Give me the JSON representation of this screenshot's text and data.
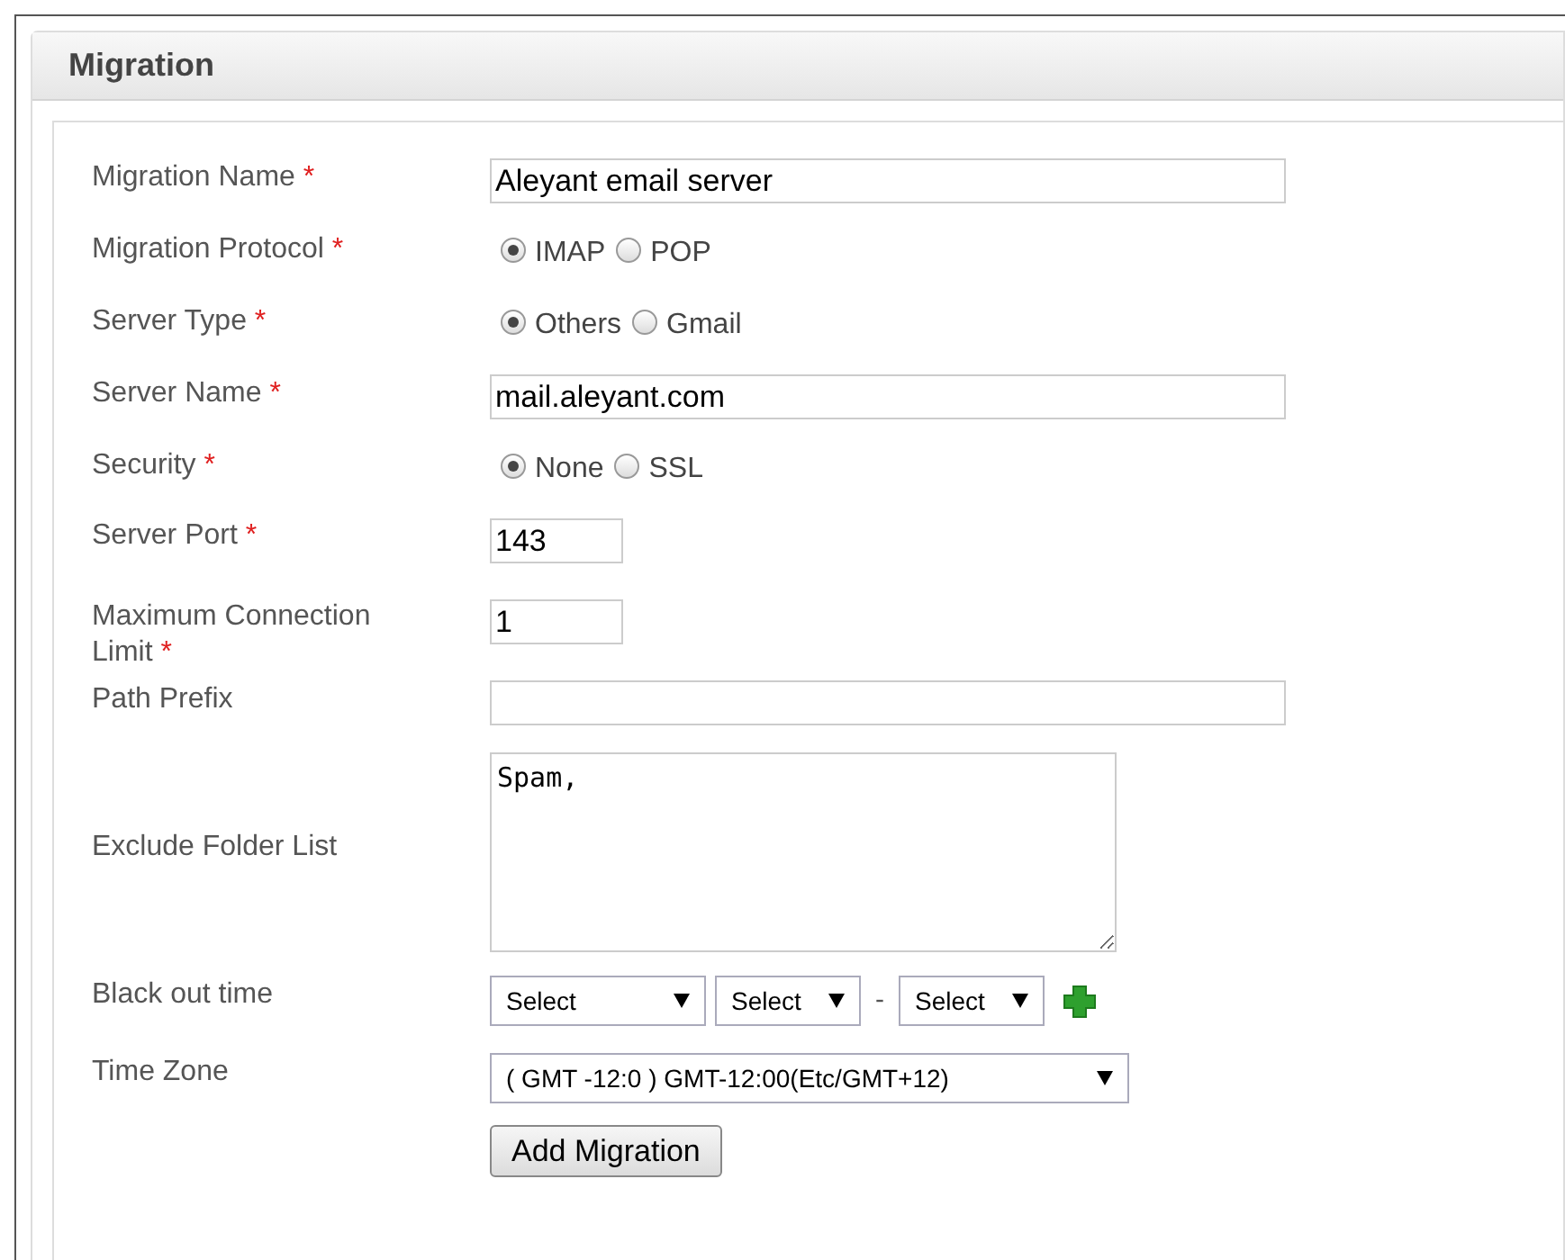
{
  "panel": {
    "title": "Migration"
  },
  "fields": [
    {
      "kind": "text",
      "label": "Migration Name",
      "required_mark": "*",
      "value": "Aleyant email server"
    },
    {
      "kind": "radio",
      "label": "Migration Protocol",
      "required_mark": "*",
      "options": [
        {
          "label": "IMAP",
          "selected": true
        },
        {
          "label": "POP",
          "selected": false
        }
      ]
    },
    {
      "kind": "radio",
      "label": "Server Type",
      "required_mark": "*",
      "options": [
        {
          "label": "Others",
          "selected": true
        },
        {
          "label": "Gmail",
          "selected": false
        }
      ]
    },
    {
      "kind": "text",
      "label": "Server Name",
      "required_mark": "*",
      "value": "mail.aleyant.com"
    },
    {
      "kind": "radio",
      "label": "Security",
      "required_mark": "*",
      "options": [
        {
          "label": "None",
          "selected": true
        },
        {
          "label": "SSL",
          "selected": false
        }
      ]
    },
    {
      "kind": "short",
      "label": "Server Port",
      "required_mark": "*",
      "value": "143"
    },
    {
      "kind": "short",
      "label": "Maximum Connection Limit",
      "required_mark": "*",
      "value": "1"
    },
    {
      "kind": "text",
      "label": "Path Prefix"
    },
    {
      "kind": "textarea",
      "label": "Exclude Folder List",
      "value": "Spam,"
    },
    {
      "kind": "blackout",
      "label": "Black out time",
      "selects": [
        "Select",
        "Select",
        "Select"
      ],
      "separator": "-"
    },
    {
      "kind": "select",
      "label": "Time Zone",
      "value": "( GMT -12:0 ) GMT-12:00(Etc/GMT+12)"
    }
  ],
  "submit": {
    "label": "Add Migration"
  }
}
